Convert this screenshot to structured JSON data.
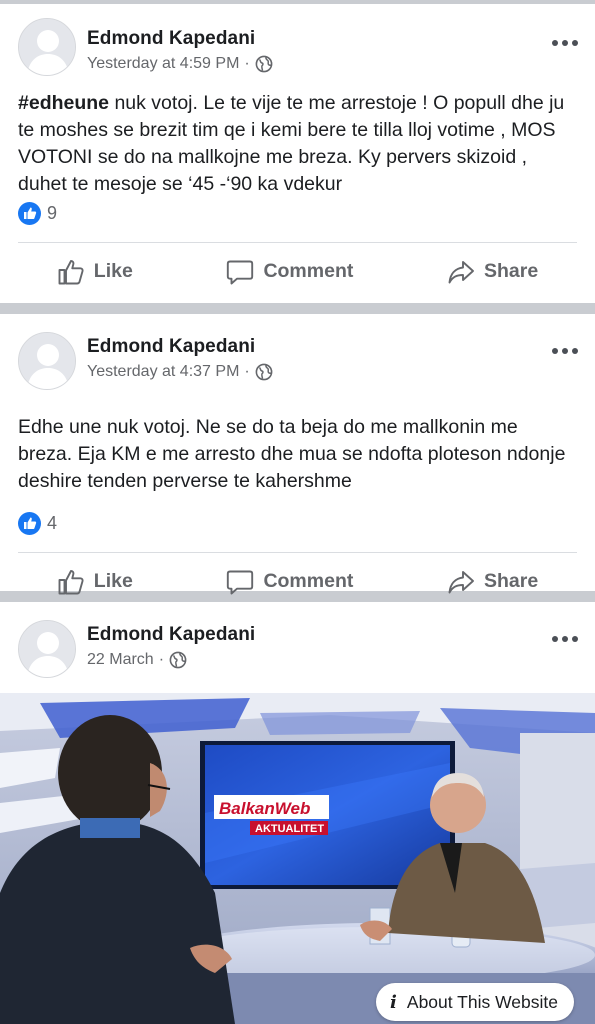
{
  "posts": [
    {
      "author": "Edmond Kapedani",
      "time": "Yesterday at 4:59 PM",
      "privacy_icon": "globe-icon",
      "hashtag": "#edheune",
      "text": " nuk votoj. Le te vije te me arrestoje ! O popull dhe ju te moshes se brezit tim qe i kemi  bere te tilla lloj votime , MOS VOTONI se do na mallkojne me breza. Ky pervers skizoid , duhet te mesoje se ‘45 -‘90 ka vdekur",
      "like_count": "9",
      "actions": {
        "like": "Like",
        "comment": "Comment",
        "share": "Share"
      }
    },
    {
      "author": "Edmond Kapedani",
      "time": "Yesterday at 4:37 PM",
      "privacy_icon": "globe-icon",
      "text": "Edhe une nuk votoj. Ne se do ta beja do me mallkonin me breza. Eja KM e me arresto dhe mua se ndofta ploteson ndonje deshire tenden perverse te kahershme",
      "like_count": "4",
      "actions": {
        "like": "Like",
        "comment": "Comment",
        "share": "Share"
      }
    },
    {
      "author": "Edmond Kapedani",
      "time": "22 March",
      "privacy_icon": "globe-icon",
      "image": {
        "logo_text": "BalkanWeb",
        "logo_sub": "AKTUALITET",
        "about_label": "About This Website"
      }
    }
  ],
  "colors": {
    "separator": "#c9ccd1",
    "like_blue": "#1877f2",
    "secondary_text": "#65676b"
  }
}
